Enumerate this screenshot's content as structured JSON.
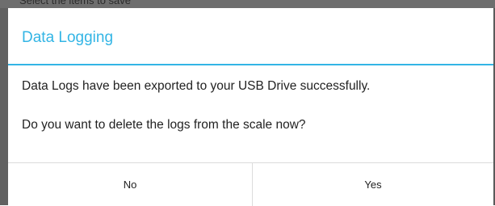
{
  "background": {
    "partial_text": "Select the items to save"
  },
  "dialog": {
    "title": "Data Logging",
    "message_line_1": "Data Logs have been exported to your USB Drive successfully.",
    "message_line_2": "Do you want to delete the logs from the scale now?",
    "negative_button": "No",
    "positive_button": "Yes"
  },
  "colors": {
    "accent": "#33b5e5",
    "text": "#222222",
    "dim_background": "#6e6e6e"
  }
}
